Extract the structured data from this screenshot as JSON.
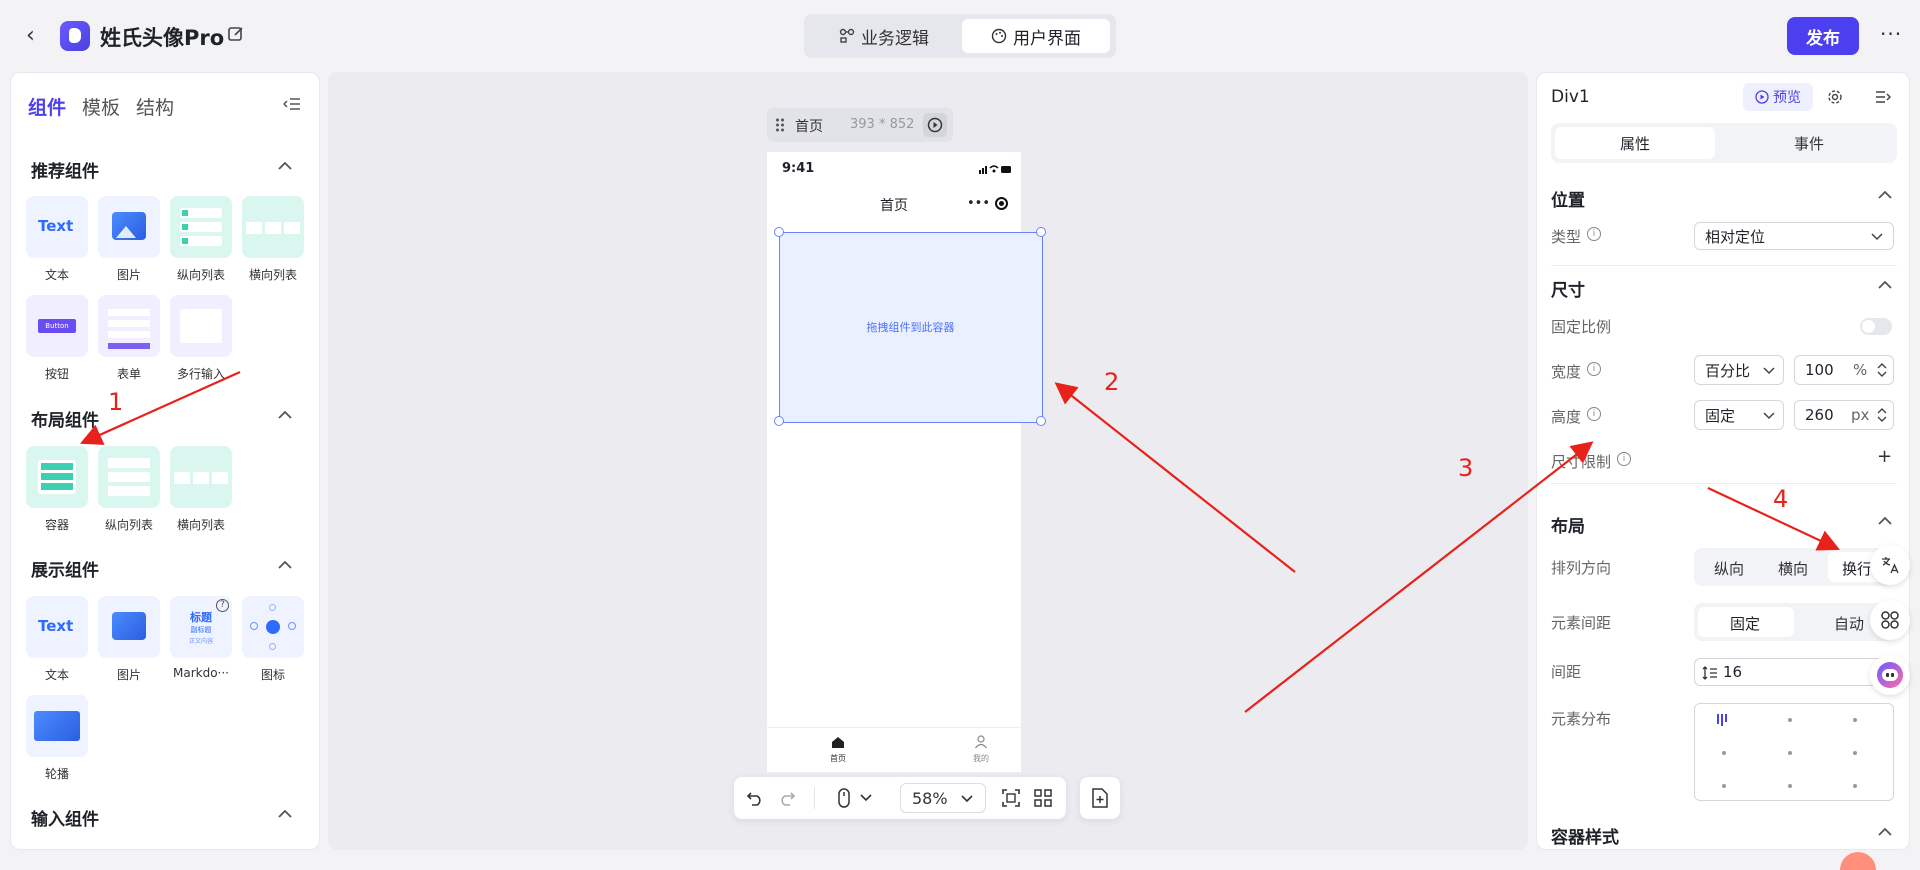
{
  "header": {
    "app_name": "姓氏头像Pro",
    "tabs": [
      {
        "label": "业务逻辑"
      },
      {
        "label": "用户界面"
      }
    ],
    "publish_label": "发布",
    "more_label": "···"
  },
  "left_panel": {
    "tabs": [
      {
        "label": "组件"
      },
      {
        "label": "模板"
      },
      {
        "label": "结构"
      }
    ],
    "sections": {
      "recommended": {
        "title": "推荐组件",
        "items": [
          {
            "label": "文本",
            "tile_text": "Text"
          },
          {
            "label": "图片"
          },
          {
            "label": "纵向列表"
          },
          {
            "label": "横向列表"
          },
          {
            "label": "按钮",
            "tile_text": "Button"
          },
          {
            "label": "表单"
          },
          {
            "label": "多行输入"
          }
        ]
      },
      "layout": {
        "title": "布局组件",
        "items": [
          {
            "label": "容器"
          },
          {
            "label": "纵向列表"
          },
          {
            "label": "横向列表"
          }
        ]
      },
      "display": {
        "title": "展示组件",
        "items": [
          {
            "label": "文本",
            "tile_text": "Text"
          },
          {
            "label": "图片"
          },
          {
            "label": "Markdo···",
            "tile_title": "标题",
            "tile_sub": "副标题",
            "tile_body": "正文内容"
          },
          {
            "label": "图标"
          },
          {
            "label": "轮播"
          }
        ]
      },
      "input": {
        "title": "输入组件"
      }
    }
  },
  "canvas": {
    "page_name": "首页",
    "page_size": "393 * 852",
    "phone": {
      "time": "9:41",
      "nav_title": "首页",
      "drop_hint": "拖拽组件到此容器",
      "tabbar": [
        {
          "label": "首页"
        },
        {
          "label": "我的"
        }
      ]
    },
    "zoom": "58%"
  },
  "right_panel": {
    "component_name": "Div1",
    "preview_label": "预览",
    "tabs": [
      {
        "label": "属性"
      },
      {
        "label": "事件"
      }
    ],
    "position": {
      "title": "位置",
      "type_label": "类型",
      "type_value": "相对定位"
    },
    "size": {
      "title": "尺寸",
      "ratio_label": "固定比例",
      "width_label": "宽度",
      "width_mode": "百分比",
      "width_value": "100",
      "width_unit": "%",
      "height_label": "高度",
      "height_mode": "固定",
      "height_value": "260",
      "height_unit": "px",
      "limit_label": "尺寸限制"
    },
    "layout": {
      "title": "布局",
      "direction_label": "排列方向",
      "direction_options": [
        "纵向",
        "横向",
        "换行"
      ],
      "gap_label": "元素间距",
      "gap_options": [
        "固定",
        "自动"
      ],
      "spacing_label": "间距",
      "spacing_value": "16",
      "distribution_label": "元素分布"
    },
    "container_style_title": "容器样式"
  },
  "annotations": {
    "one": "1",
    "two": "2",
    "three": "3",
    "four": "4"
  },
  "colors": {
    "accent": "#4c3ff0",
    "annotation": "#e8221b",
    "container_border": "#6a84ff"
  }
}
